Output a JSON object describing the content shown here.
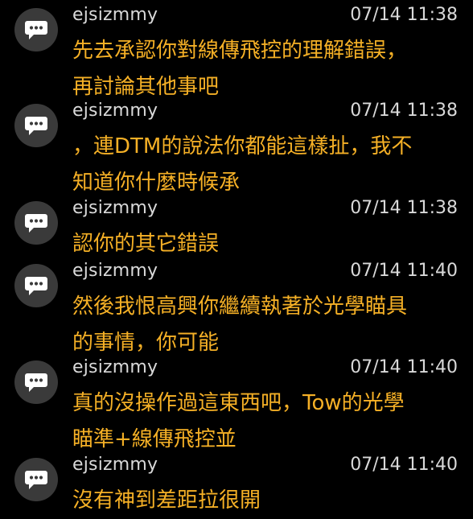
{
  "comments": [
    {
      "username": "ejsizmmy",
      "timestamp": "07/14 11:38",
      "lines": [
        "先去承認你對線傳飛控的理解錯誤，",
        "再討論其他事吧"
      ]
    },
    {
      "username": "ejsizmmy",
      "timestamp": "07/14 11:38",
      "lines": [
        "，連DTM的說法你都能這樣扯，我不",
        "知道你什麼時候承"
      ]
    },
    {
      "username": "ejsizmmy",
      "timestamp": "07/14 11:38",
      "lines": [
        "認你的其它錯誤"
      ]
    },
    {
      "username": "ejsizmmy",
      "timestamp": "07/14 11:40",
      "lines": [
        "然後我恨高興你繼續執著於光學瞄具",
        "的事情，你可能"
      ]
    },
    {
      "username": "ejsizmmy",
      "timestamp": "07/14 11:40",
      "lines": [
        "真的沒操作過這東西吧，Tow的光學",
        "瞄準+線傳飛控並"
      ]
    },
    {
      "username": "ejsizmmy",
      "timestamp": "07/14 11:40",
      "lines": [
        "沒有神到差距拉很開"
      ]
    }
  ],
  "colors": {
    "background": "#000000",
    "avatar": "#3a3a3a",
    "meta_text": "#d9d9d9",
    "body_text": "#f5b026"
  },
  "icons": {
    "avatar": "speech-bubble-icon"
  }
}
